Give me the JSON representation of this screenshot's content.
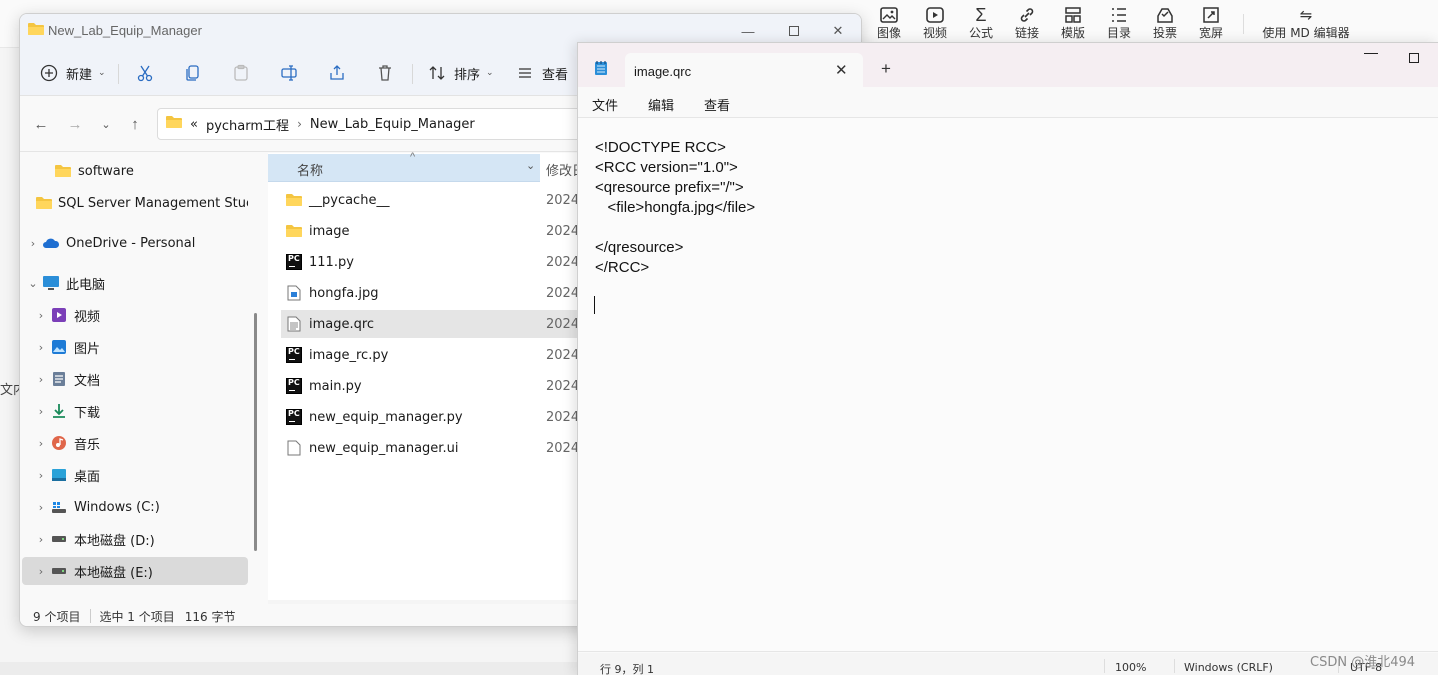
{
  "bg_toolbar": {
    "tools": [
      {
        "icon": "image-icon",
        "label": "图像"
      },
      {
        "icon": "video-icon",
        "label": "视频"
      },
      {
        "icon": "formula-icon",
        "label": "公式"
      },
      {
        "icon": "link-icon",
        "label": "链接"
      },
      {
        "icon": "template-icon",
        "label": "模版"
      },
      {
        "icon": "toc-icon",
        "label": "目录"
      },
      {
        "icon": "vote-icon",
        "label": "投票"
      },
      {
        "icon": "wide-screen-icon",
        "label": "宽屏"
      }
    ],
    "md_editor_label": "使用 MD 编辑器",
    "left_fragment": "文内"
  },
  "explorer": {
    "title": "New_Lab_Equip_Manager",
    "commands": {
      "new": "新建",
      "sort": "排序",
      "view": "查看"
    },
    "breadcrumb": {
      "overflow": "«",
      "parts": [
        "pycharm工程",
        "New_Lab_Equip_Manager"
      ]
    },
    "nav_items": [
      {
        "label": "software",
        "icon": "folder-icon"
      },
      {
        "label": "SQL Server Management Stuc",
        "icon": "folder-icon"
      },
      {
        "label": "OneDrive - Personal",
        "icon": "onedrive-icon"
      },
      {
        "label": "此电脑",
        "icon": "this-pc-icon"
      },
      {
        "label": "视频",
        "icon": "videos-icon"
      },
      {
        "label": "图片",
        "icon": "pictures-icon"
      },
      {
        "label": "文档",
        "icon": "documents-icon"
      },
      {
        "label": "下载",
        "icon": "downloads-icon"
      },
      {
        "label": "音乐",
        "icon": "music-icon"
      },
      {
        "label": "桌面",
        "icon": "desktop-icon"
      },
      {
        "label": "Windows (C:)",
        "icon": "windows-drive-icon"
      },
      {
        "label": "本地磁盘 (D:)",
        "icon": "drive-icon"
      },
      {
        "label": "本地磁盘 (E:)",
        "icon": "drive-icon"
      }
    ],
    "columns": {
      "name": "名称",
      "modified": "修改日"
    },
    "files": [
      {
        "name": "__pycache__",
        "date": "2024/",
        "type": "folder"
      },
      {
        "name": "image",
        "date": "2024/",
        "type": "folder"
      },
      {
        "name": "111.py",
        "date": "2024/",
        "type": "pycharm"
      },
      {
        "name": "hongfa.jpg",
        "date": "2024/",
        "type": "image"
      },
      {
        "name": "image.qrc",
        "date": "2024/",
        "type": "text"
      },
      {
        "name": "image_rc.py",
        "date": "2024/",
        "type": "pycharm"
      },
      {
        "name": "main.py",
        "date": "2024/",
        "type": "pycharm"
      },
      {
        "name": "new_equip_manager.py",
        "date": "2024/",
        "type": "pycharm"
      },
      {
        "name": "new_equip_manager.ui",
        "date": "2024/",
        "type": "file"
      }
    ],
    "status": {
      "count": "9 个项目",
      "selection": "选中 1 个项目",
      "size": "116 字节"
    }
  },
  "notepad": {
    "tab_title": "image.qrc",
    "menus": [
      "文件",
      "编辑",
      "查看"
    ],
    "content": "<!DOCTYPE RCC>\n<RCC version=\"1.0\">\n<qresource prefix=\"/\">\n   <file>hongfa.jpg</file>\n\n</qresource>\n</RCC>",
    "status": {
      "position": "行 9，列 1",
      "zoom": "100%",
      "line_ending": "Windows (CRLF)",
      "encoding": "UTF-8"
    }
  },
  "watermark": "CSDN @淮北494"
}
